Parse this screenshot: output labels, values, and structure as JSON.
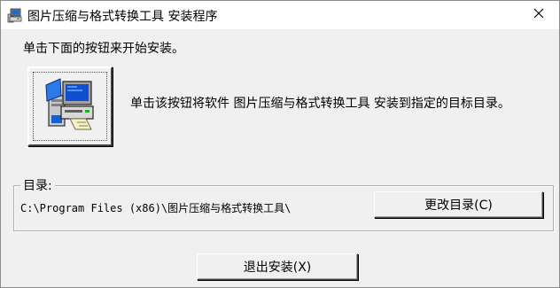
{
  "window": {
    "title": "图片压缩与格式转换工具 安装程序"
  },
  "main": {
    "instruction": "单击下面的按钮来开始安装。",
    "install_description": "单击该按钮将软件 图片压缩与格式转换工具 安装到指定的目标目录。"
  },
  "directory": {
    "legend": "目录:",
    "path": "C:\\Program Files (x86)\\图片压缩与格式转换工具\\",
    "change_label": "更改目录(C)"
  },
  "footer": {
    "exit_label": "退出安装(X)"
  },
  "icons": {
    "title": "setup-computer-icon",
    "install": "computer-install-icon",
    "close": "close-icon"
  }
}
